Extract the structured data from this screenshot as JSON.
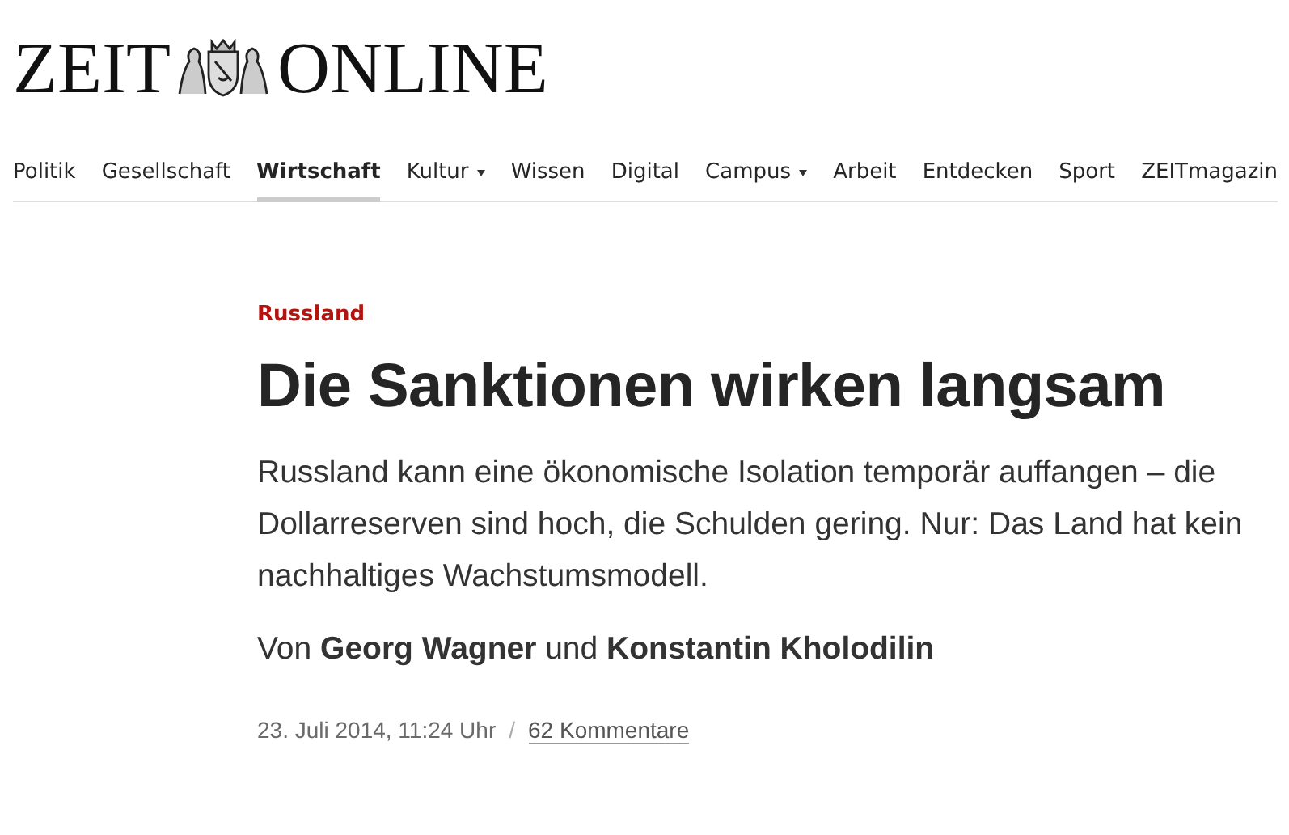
{
  "logo": {
    "left": "ZEIT",
    "right": "ONLINE"
  },
  "nav": [
    {
      "label": "Politik",
      "selected": false,
      "dropdown": false
    },
    {
      "label": "Gesellschaft",
      "selected": false,
      "dropdown": false
    },
    {
      "label": "Wirtschaft",
      "selected": true,
      "dropdown": false
    },
    {
      "label": "Kultur",
      "selected": false,
      "dropdown": true
    },
    {
      "label": "Wissen",
      "selected": false,
      "dropdown": false
    },
    {
      "label": "Digital",
      "selected": false,
      "dropdown": false
    },
    {
      "label": "Campus",
      "selected": false,
      "dropdown": true
    },
    {
      "label": "Arbeit",
      "selected": false,
      "dropdown": false
    },
    {
      "label": "Entdecken",
      "selected": false,
      "dropdown": false
    },
    {
      "label": "Sport",
      "selected": false,
      "dropdown": false
    },
    {
      "label": "ZEITmagazin",
      "selected": false,
      "dropdown": false
    }
  ],
  "article": {
    "kicker": "Russland",
    "headline": "Die Sanktionen wirken langsam",
    "summary": "Russland kann eine ökonomische Isolation temporär auffangen – die Dollarreserven sind hoch, die Schulden gering. Nur: Das Land hat kein nachhaltiges Wachstumsmodell.",
    "byline": "Von **Georg Wagner** und **Konstantin Kholodilin**",
    "date": "23. Juli 2014, 11:24 Uhr",
    "separator": "/",
    "comments": "62 Kommentare"
  }
}
